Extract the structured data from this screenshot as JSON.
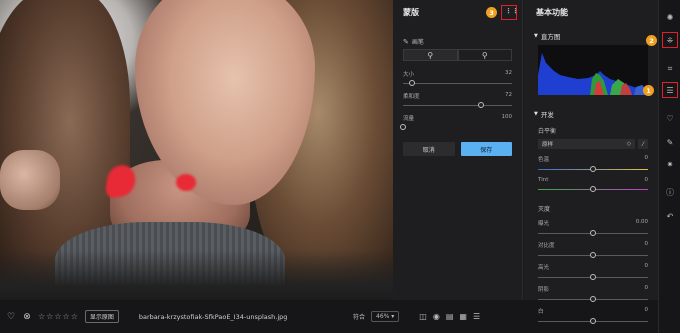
{
  "photo": {
    "filename": "barbara-krzystofiak-SfkPaoE_I34-unsplash.jpg",
    "compare_label": "显示原图",
    "rating_stars": "☆☆☆☆☆"
  },
  "bottom_bar": {
    "fit_label": "符合",
    "zoom_label": "46% ▾"
  },
  "mask_panel": {
    "title": "蒙版",
    "brush_label": "画笔",
    "sliders": [
      {
        "label": "大小",
        "value": "32",
        "position": 0.08
      },
      {
        "label": "柔和度",
        "value": "72",
        "position": 0.72
      },
      {
        "label": "流量",
        "value": "100",
        "position": 0.0
      }
    ],
    "cancel_label": "取消",
    "save_label": "保存"
  },
  "basic_panel": {
    "title": "基本功能",
    "histogram_label": "直方图",
    "develop_label": "开发",
    "white_balance_label": "白平衡",
    "wb_value": "原样",
    "wb_sliders": [
      {
        "label": "色温",
        "value": "0",
        "position": 0.5
      },
      {
        "label": "Tint",
        "value": "0",
        "position": 0.5
      }
    ],
    "exposure_section_label": "灭度",
    "exposure_sliders": [
      {
        "label": "曝光",
        "value": "0.00",
        "position": 0.5
      },
      {
        "label": "对比度",
        "value": "0",
        "position": 0.5
      },
      {
        "label": "高光",
        "value": "0",
        "position": 0.5
      },
      {
        "label": "阴影",
        "value": "0",
        "position": 0.5
      },
      {
        "label": "白",
        "value": "0",
        "position": 0.5
      }
    ]
  },
  "callouts": {
    "one": "1",
    "two": "2",
    "three": "3"
  },
  "toolbar_icons": [
    "star-badge-icon",
    "mask-grid-icon",
    "crop-icon",
    "sliders-icon",
    "heal-icon",
    "brush-icon",
    "effects-icon",
    "info-icon",
    "undo-icon"
  ],
  "colors": {
    "accent_blue": "#5ab0f0",
    "callout_orange": "#f0a020",
    "highlight_red": "#e0202a",
    "mask_red": "#e82a36"
  }
}
